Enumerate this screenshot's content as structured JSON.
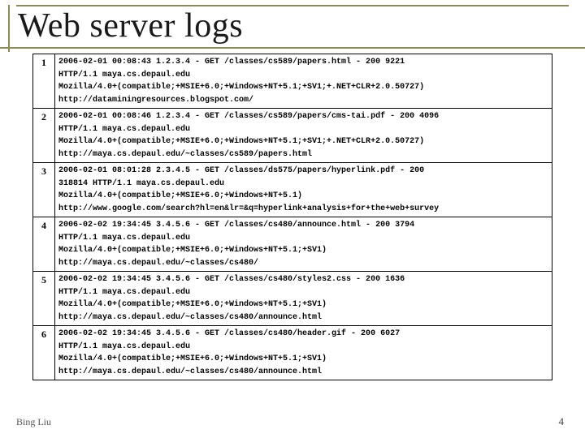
{
  "slide": {
    "title": "Web server logs",
    "footer_author": "Bing Liu",
    "footer_page": "4"
  },
  "log_entries": [
    {
      "idx": "1",
      "lines": [
        "2006-02-01 00:08:43 1.2.3.4 - GET /classes/cs589/papers.html - 200 9221",
        "HTTP/1.1 maya.cs.depaul.edu",
        "Mozilla/4.0+(compatible;+MSIE+6.0;+Windows+NT+5.1;+SV1;+.NET+CLR+2.0.50727)",
        "http://dataminingresources.blogspot.com/"
      ]
    },
    {
      "idx": "2",
      "lines": [
        "2006-02-01 00:08:46 1.2.3.4 - GET /classes/cs589/papers/cms-tai.pdf - 200 4096",
        "HTTP/1.1 maya.cs.depaul.edu",
        "Mozilla/4.0+(compatible;+MSIE+6.0;+Windows+NT+5.1;+SV1;+.NET+CLR+2.0.50727)",
        "http://maya.cs.depaul.edu/~classes/cs589/papers.html"
      ]
    },
    {
      "idx": "3",
      "lines": [
        "2006-02-01 08:01:28 2.3.4.5 - GET /classes/ds575/papers/hyperlink.pdf - 200",
        "318814 HTTP/1.1 maya.cs.depaul.edu",
        "Mozilla/4.0+(compatible;+MSIE+6.0;+Windows+NT+5.1)",
        "http://www.google.com/search?hl=en&lr=&q=hyperlink+analysis+for+the+web+survey"
      ]
    },
    {
      "idx": "4",
      "lines": [
        "2006-02-02 19:34:45 3.4.5.6 - GET /classes/cs480/announce.html - 200 3794",
        "HTTP/1.1 maya.cs.depaul.edu",
        "Mozilla/4.0+(compatible;+MSIE+6.0;+Windows+NT+5.1;+SV1)",
        "http://maya.cs.depaul.edu/~classes/cs480/"
      ]
    },
    {
      "idx": "5",
      "lines": [
        "2006-02-02 19:34:45 3.4.5.6 - GET /classes/cs480/styles2.css - 200 1636",
        "HTTP/1.1 maya.cs.depaul.edu",
        "Mozilla/4.0+(compatible;+MSIE+6.0;+Windows+NT+5.1;+SV1)",
        "http://maya.cs.depaul.edu/~classes/cs480/announce.html"
      ]
    },
    {
      "idx": "6",
      "lines": [
        "2006-02-02 19:34:45 3.4.5.6 - GET /classes/cs480/header.gif - 200 6027",
        "HTTP/1.1 maya.cs.depaul.edu",
        "Mozilla/4.0+(compatible;+MSIE+6.0;+Windows+NT+5.1;+SV1)",
        "http://maya.cs.depaul.edu/~classes/cs480/announce.html"
      ]
    }
  ]
}
